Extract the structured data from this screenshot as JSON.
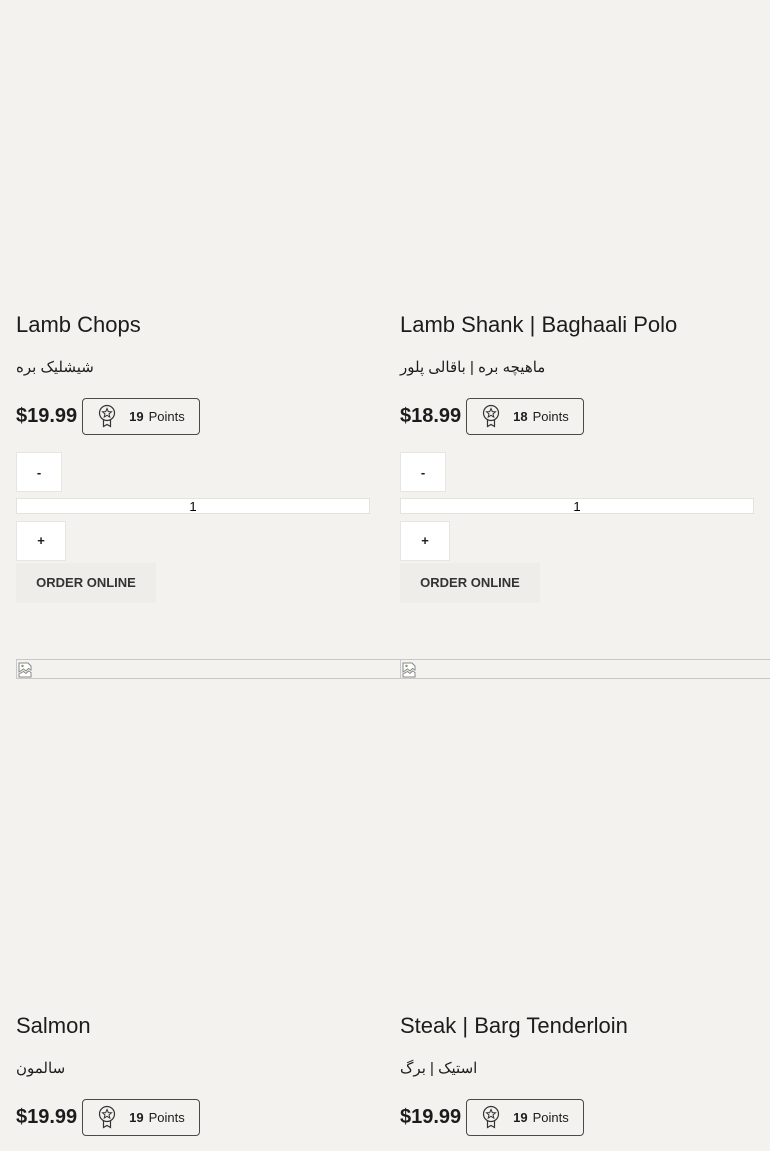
{
  "products": [
    {
      "title": "Lamb Chops",
      "subtitle": "شیشلیک بره",
      "price": "$19.99",
      "points_value": "19",
      "points_label": "Points",
      "quantity": "1",
      "minus_label": "-",
      "plus_label": "+",
      "order_label": "ORDER ONLINE"
    },
    {
      "title": "Lamb Shank | Baghaali Polo",
      "subtitle": "ماهیچه بره | باقالی پلور",
      "price": "$18.99",
      "points_value": "18",
      "points_label": "Points",
      "quantity": "1",
      "minus_label": "-",
      "plus_label": "+",
      "order_label": "ORDER ONLINE"
    },
    {
      "title": "Salmon",
      "subtitle": "سالمون",
      "price": "$19.99",
      "points_value": "19",
      "points_label": "Points"
    },
    {
      "title": "Steak | Barg Tenderloin",
      "subtitle": "استیک | برگ",
      "price": "$19.99",
      "points_value": "19",
      "points_label": "Points"
    }
  ],
  "icons": {
    "points": "medal-star-icon",
    "broken_image": "broken-image-icon"
  }
}
